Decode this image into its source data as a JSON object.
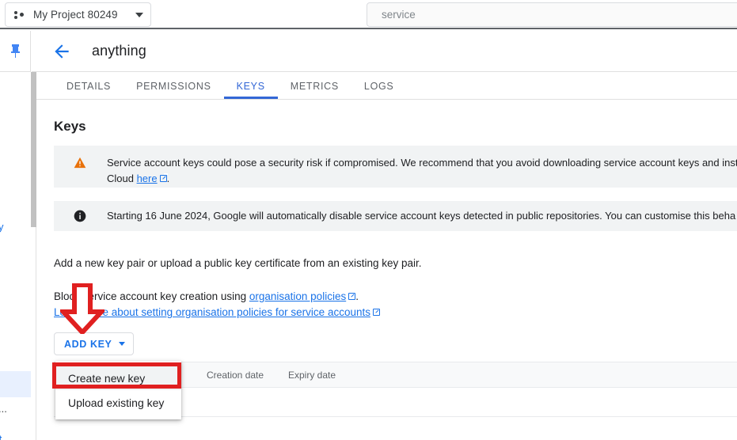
{
  "topbar": {
    "project_chip": {
      "icon": "project-dots-icon",
      "label": "My Project 80249",
      "caret": "chevron-down-icon"
    },
    "search": {
      "value": "service",
      "placeholder": "service"
    }
  },
  "rail": {
    "pin_icon": "pin-icon"
  },
  "sidebar_fragments": [
    "y",
    "...",
    "t..."
  ],
  "content_header": {
    "back_icon": "arrow-left-icon",
    "title": "anything"
  },
  "tabs": [
    {
      "label": "DETAILS",
      "active": false
    },
    {
      "label": "PERMISSIONS",
      "active": false
    },
    {
      "label": "KEYS",
      "active": true
    },
    {
      "label": "METRICS",
      "active": false
    },
    {
      "label": "LOGS",
      "active": false
    }
  ],
  "main": {
    "heading": "Keys",
    "banner_warning": {
      "icon": "warning-triangle-icon",
      "icon_color": "#e8710a",
      "text_before_link": "Service account keys could pose a security risk if compromised. We recommend that you avoid downloading service account keys and inst",
      "line2_before_link": "Cloud ",
      "link_text": "here",
      "line2_after_link": "."
    },
    "banner_info": {
      "icon": "info-circle-icon",
      "icon_color": "#202124",
      "text": "Starting 16 June 2024, Google will automatically disable service account keys detected in public repositories. You can customise this beha"
    },
    "para_add": "Add a new key pair or upload a public key certificate from an existing key pair.",
    "para_block": {
      "before_link": "Block service account key creation using ",
      "link_text": "organisation policies",
      "after_link": "."
    },
    "para_learn": {
      "link_text": "Learn more about setting organisation policies for service accounts"
    },
    "add_key_button": {
      "label": "ADD KEY",
      "caret": "chevron-down-icon"
    },
    "menu": {
      "items": [
        {
          "label": "Create new key",
          "highlighted": true
        },
        {
          "label": "Upload existing key",
          "highlighted": false
        }
      ]
    },
    "table": {
      "columns": [
        "",
        "Creation date",
        "Expiry date"
      ],
      "rows": []
    }
  },
  "annotations": {
    "arrow": {
      "name": "red-down-arrow",
      "color": "#e02020"
    },
    "rect": {
      "name": "red-highlight-rect",
      "color": "#e02020"
    }
  }
}
